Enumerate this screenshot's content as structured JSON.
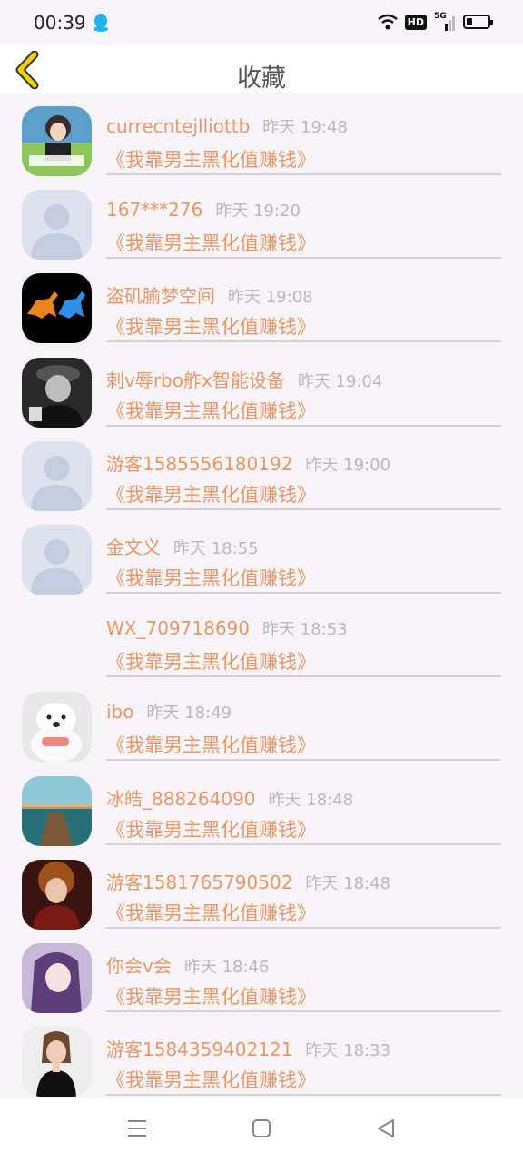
{
  "status_bar": {
    "time": "00:39",
    "hd": "HD",
    "net": "5G"
  },
  "header": {
    "title": "收藏"
  },
  "items": [
    {
      "name": "currecntejlliottb",
      "time": "昨天 19:48",
      "book": "《我靠男主黑化值赚钱》",
      "avatar": "photo-anime"
    },
    {
      "name": "167***276",
      "time": "昨天 19:20",
      "book": "《我靠男主黑化值赚钱》",
      "avatar": "default"
    },
    {
      "name": "盗矶腧梦空间",
      "time": "昨天 19:08",
      "book": "《我靠男主黑化值赚钱》",
      "avatar": "horses"
    },
    {
      "name": "剌v辱rbo舴x智能设备",
      "time": "昨天 19:04",
      "book": "《我靠男主黑化值赚钱》",
      "avatar": "bw-photo"
    },
    {
      "name": "游客1585556180192",
      "time": "昨天 19:00",
      "book": "《我靠男主黑化值赚钱》",
      "avatar": "default"
    },
    {
      "name": "金文义",
      "time": "昨天 18:55",
      "book": "《我靠男主黑化值赚钱》",
      "avatar": "default"
    },
    {
      "name": "WX_709718690",
      "time": "昨天 18:53",
      "book": "《我靠男主黑化值赚钱》",
      "avatar": "none"
    },
    {
      "name": "ibo",
      "time": "昨天 18:49",
      "book": "《我靠男主黑化值赚钱》",
      "avatar": "plush-toy"
    },
    {
      "name": "冰皓_888264090",
      "time": "昨天 18:48",
      "book": "《我靠男主黑化值赚钱》",
      "avatar": "pier"
    },
    {
      "name": "游客1581765790502",
      "time": "昨天 18:48",
      "book": "《我靠男主黑化值赚钱》",
      "avatar": "dark-art"
    },
    {
      "name": "你会v会",
      "time": "昨天 18:46",
      "book": "《我靠男主黑化值赚钱》",
      "avatar": "anime-girl"
    },
    {
      "name": "游客1584359402121",
      "time": "昨天 18:33",
      "book": "《我靠男主黑化值赚钱》",
      "avatar": "woman-photo"
    }
  ],
  "colors": {
    "accent": "#e6986a",
    "time": "#b9b9b9",
    "back": "#f0d000"
  }
}
